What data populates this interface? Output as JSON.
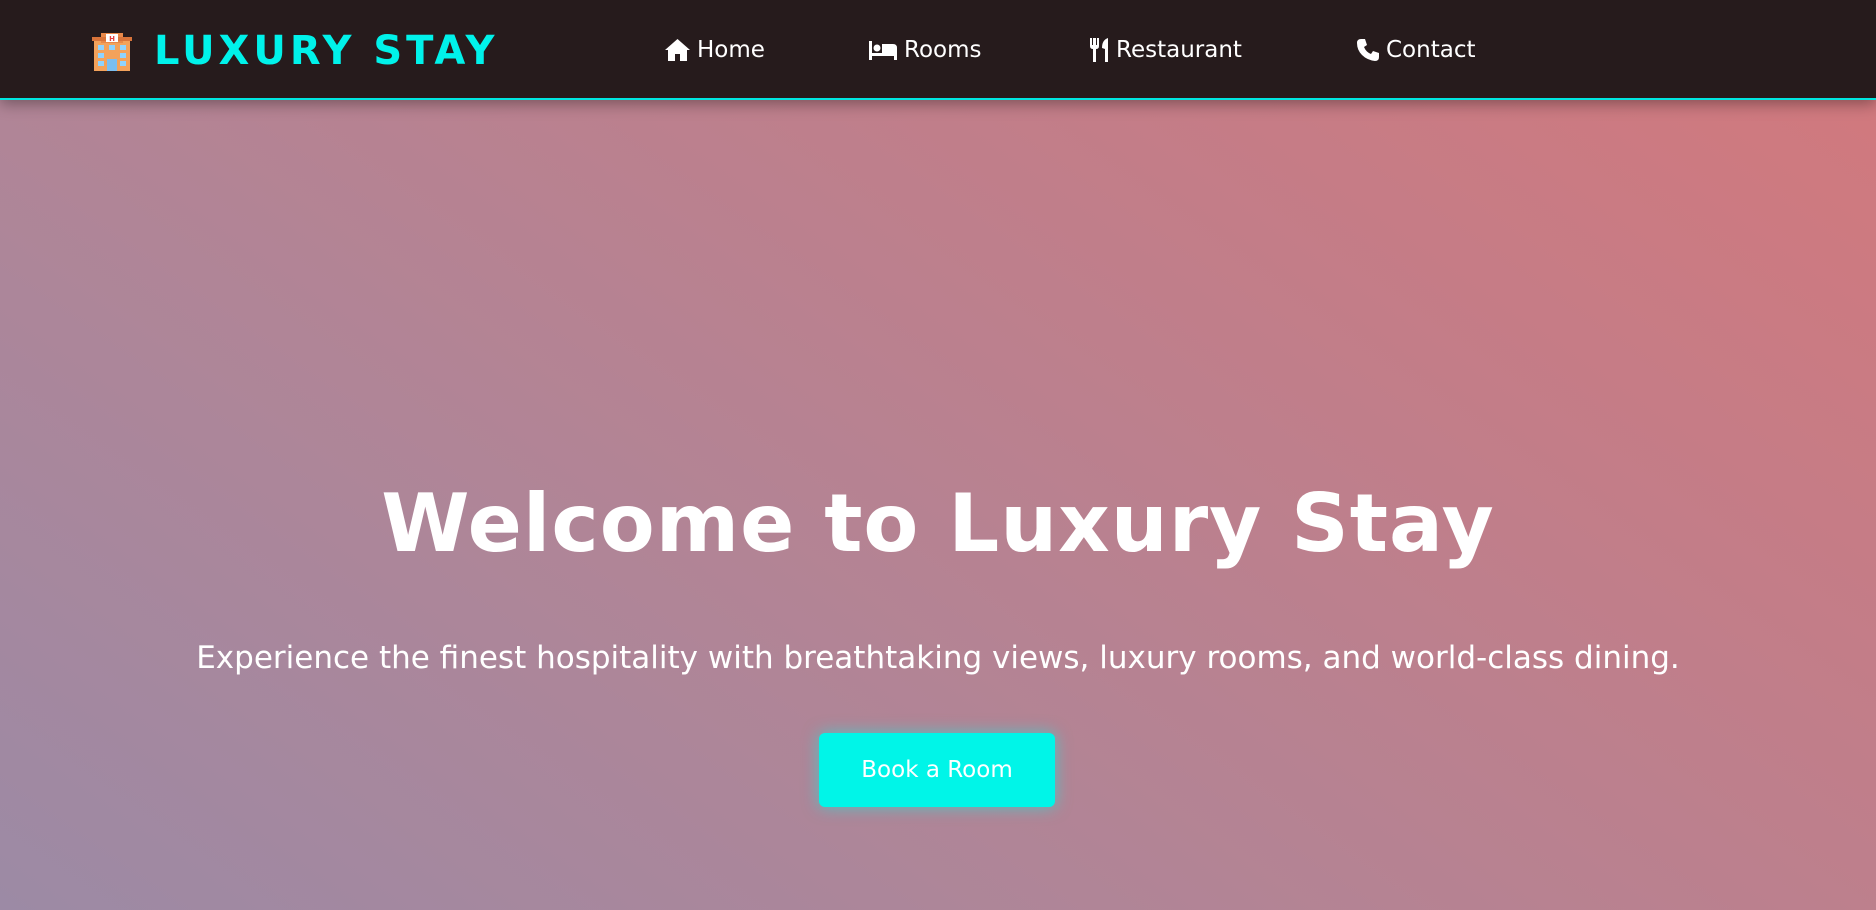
{
  "theme": {
    "brand_color": "#00f2ea",
    "navbar_bg": "#261b1c",
    "button_color": "#00f5e8",
    "text_color": "#ffffff"
  },
  "brand": {
    "icon": "hotel-icon",
    "name": "LUXURY STAY"
  },
  "nav": {
    "items": [
      {
        "icon": "home-icon",
        "label": "Home"
      },
      {
        "icon": "bed-icon",
        "label": "Rooms"
      },
      {
        "icon": "utensils-icon",
        "label": "Restaurant"
      },
      {
        "icon": "phone-icon",
        "label": "Contact"
      }
    ]
  },
  "hero": {
    "title": "Welcome to Luxury Stay",
    "subtitle": "Experience the finest hospitality with breathtaking views, luxury rooms, and world-class dining.",
    "cta_label": "Book a Room"
  }
}
